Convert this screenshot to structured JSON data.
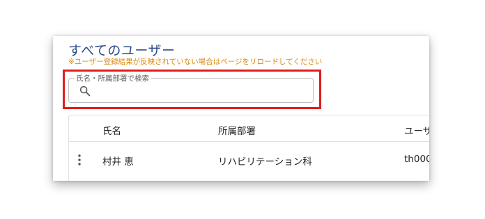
{
  "page": {
    "title": "すべてのユーザー",
    "notice": "※ユーザー登録結果が反映されていない場合はページをリロードしてください"
  },
  "search": {
    "label": "氏名・所属部署で検索",
    "value": "",
    "placeholder": ""
  },
  "table": {
    "columns": [
      "氏名",
      "所属部署",
      "ユーザ"
    ],
    "rows": [
      {
        "name": "村井 恵",
        "department": "リハビリテーション科",
        "user": "th000"
      }
    ]
  },
  "colors": {
    "title": "#2d4a8a",
    "notice": "#d98a12",
    "highlight": "#e11c1c"
  },
  "icons": {
    "search": "search-icon",
    "row_menu": "more-vert-icon"
  }
}
